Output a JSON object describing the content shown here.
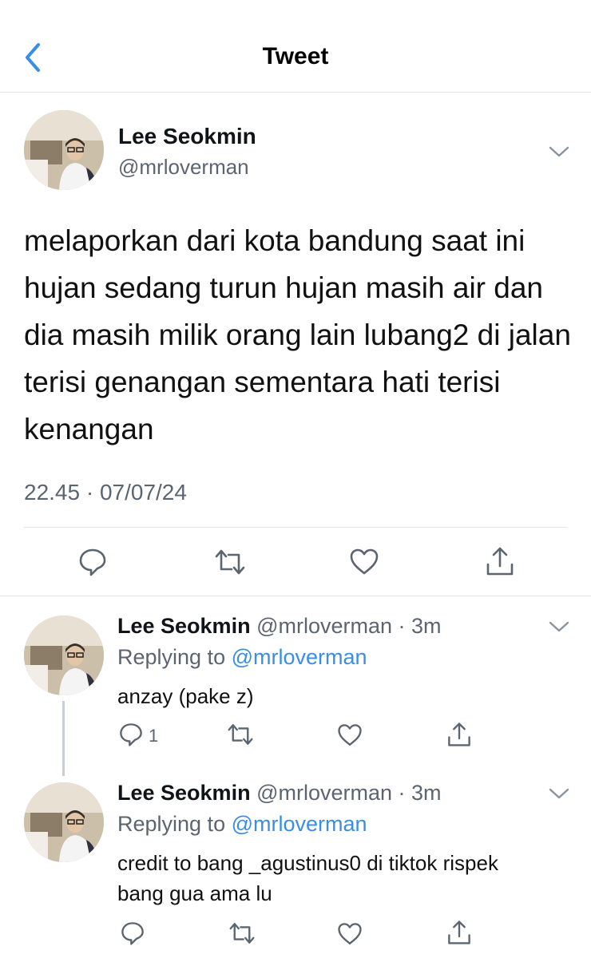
{
  "header": {
    "title": "Tweet",
    "back_icon": "chevron-left-icon",
    "accent": "#3a8ee6"
  },
  "tweet": {
    "author_name": "Lee Seokmin",
    "author_handle": "@mrloverman",
    "text": "melaporkan dari kota bandung saat ini hujan sedang turun hujan masih air dan dia masih milik orang lain lubang2 di jalan terisi genangan sementara hati terisi kenangan",
    "timestamp": "22.45 · 07/07/24"
  },
  "replies": [
    {
      "author_name": "Lee Seokmin",
      "meta": "@mrloverman · 3m",
      "replying_prefix": "Replying to",
      "replying_handle": "@mrloverman",
      "text": "anzay (pake z)",
      "reply_count": "1"
    },
    {
      "author_name": "Lee Seokmin",
      "meta": "@mrloverman · 3m",
      "replying_prefix": "Replying to",
      "replying_handle": "@mrloverman",
      "text": "credit to bang _agustinus0 di tiktok rispek bang gua ama lu",
      "reply_count": ""
    }
  ],
  "icons": {
    "reply": "reply-bubble-icon",
    "retweet": "retweet-icon",
    "like": "heart-icon",
    "share": "share-icon",
    "more": "chevron-down-icon"
  }
}
